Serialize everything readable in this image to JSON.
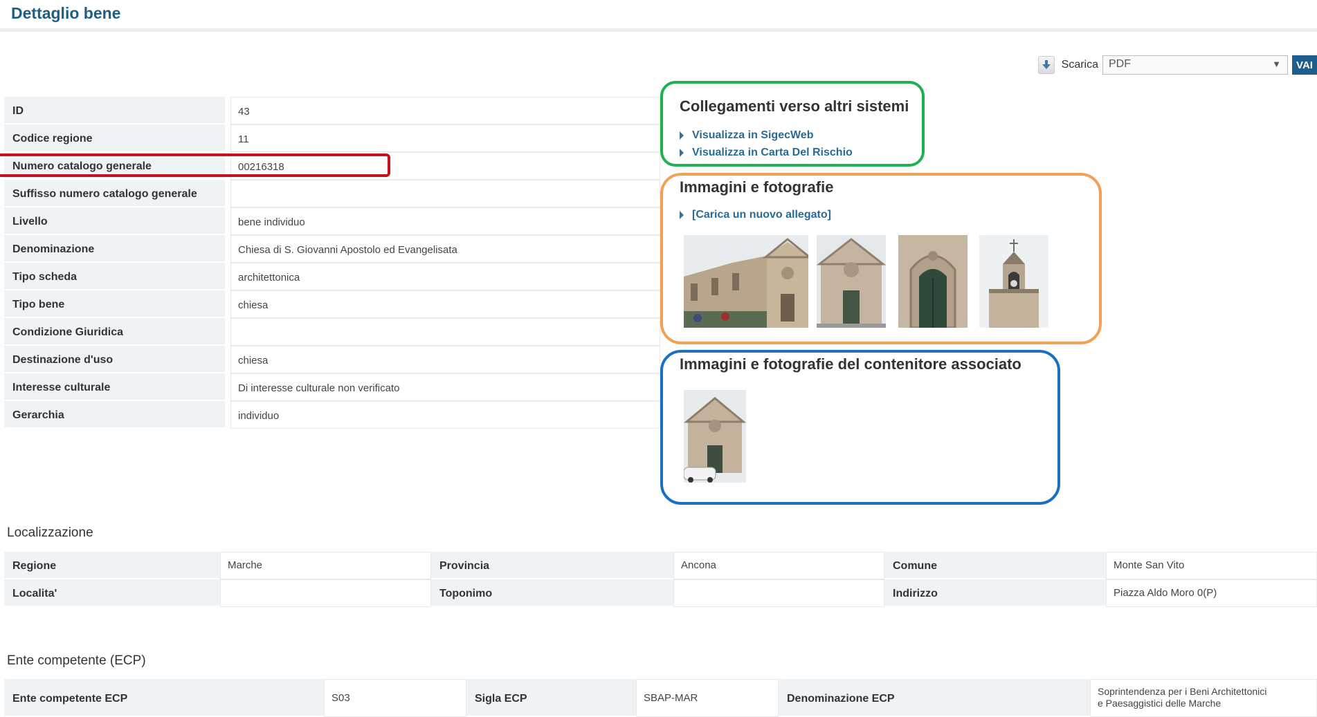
{
  "header": {
    "title": "Dettaglio bene"
  },
  "download": {
    "label": "Scarica",
    "format": "PDF",
    "go_label": "VAI",
    "icon": "download-icon"
  },
  "detail": {
    "rows": [
      {
        "label": "ID",
        "value": "43"
      },
      {
        "label": "Codice regione",
        "value": "11"
      },
      {
        "label": "Numero catalogo generale",
        "value": "00216318"
      },
      {
        "label": "Suffisso numero catalogo generale",
        "value": ""
      },
      {
        "label": "Livello",
        "value": "bene individuo"
      },
      {
        "label": "Denominazione",
        "value": "Chiesa di S. Giovanni Apostolo ed Evangelisata"
      },
      {
        "label": "Tipo scheda",
        "value": "architettonica"
      },
      {
        "label": "Tipo bene",
        "value": "chiesa"
      },
      {
        "label": "Condizione Giuridica",
        "value": ""
      },
      {
        "label": "Destinazione d'uso",
        "value": "chiesa"
      },
      {
        "label": "Interesse culturale",
        "value": "Di interesse culturale non verificato"
      },
      {
        "label": "Gerarchia",
        "value": "individuo"
      }
    ]
  },
  "links_panel": {
    "title": "Collegamenti verso altri sistemi",
    "links": [
      "Visualizza in SigecWeb",
      "Visualizza in Carta Del Rischio"
    ]
  },
  "images_panel": {
    "title": "Immagini e fotografie",
    "upload_link": "[Carica un nuovo allegato]"
  },
  "container_panel": {
    "title": "Immagini e fotografie del contenitore associato"
  },
  "localizzazione": {
    "title": "Localizzazione",
    "rows": [
      [
        {
          "label": "Regione",
          "value": "Marche"
        },
        {
          "label": "Provincia",
          "value": "Ancona"
        },
        {
          "label": "Comune",
          "value": "Monte San Vito"
        }
      ],
      [
        {
          "label": "Localita'",
          "value": ""
        },
        {
          "label": "Toponimo",
          "value": ""
        },
        {
          "label": "Indirizzo",
          "value": "Piazza Aldo Moro 0(P)"
        }
      ]
    ]
  },
  "ecp": {
    "title": "Ente competente (ECP)",
    "cells": [
      {
        "label": "Ente competente ECP",
        "value": "S03"
      },
      {
        "label": "Sigla ECP",
        "value": "SBAP-MAR"
      },
      {
        "label": "Denominazione ECP",
        "value_line1": "Soprintendenza per i Beni Architettonici",
        "value_line2": "e Paesaggistici delle Marche"
      }
    ]
  },
  "colors": {
    "accent": "#1d5e86",
    "green": "#1fb050",
    "orange": "#f2a054",
    "blue": "#1a6fc0",
    "red": "#c1121f"
  }
}
